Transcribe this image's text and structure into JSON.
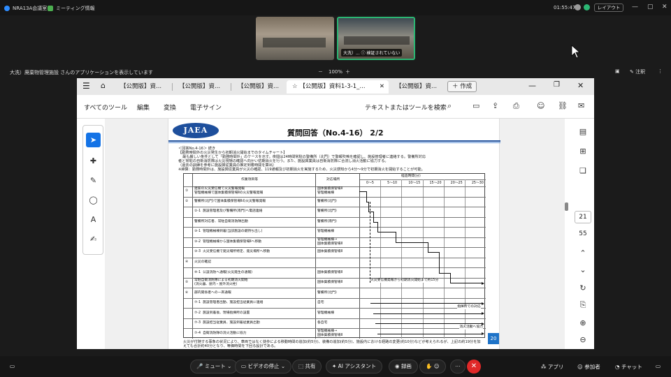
{
  "topbar": {
    "meeting_name": "NRA13A会議室",
    "meeting_info": "ミーティング情報",
    "clock": "01:55:47",
    "layout_label": "レイアウト"
  },
  "thumbnails": {
    "speaker_label": "大洗）... ⓘ 検証されていない"
  },
  "sharebar": {
    "sharing_text": "大洗）廃棄物管理施設 さんのアプリケーションを表示しています",
    "zoom": "100%",
    "annotate_label": "注釈"
  },
  "browser": {
    "tabs": [
      "【公開版】資...",
      "【公開版】資...",
      "【公開版】資...",
      "【公開版】資料1-3-1_...",
      "【公開版】資..."
    ],
    "new_tab_label": "作成"
  },
  "acrobat_menu": {
    "items": [
      "すべてのツール",
      "編集",
      "変換",
      "電子サイン"
    ],
    "search_placeholder": "テキストまたはツールを検索"
  },
  "pager": {
    "current": "21",
    "total": "55"
  },
  "document": {
    "logo": "JAEA",
    "title": "質問回答（No.4-16） 2/2",
    "heading1": "＜回答No.4-16＞ 続き",
    "heading2": "【勤務時間外の火災発生から初期消火開始までのタイムチャート】",
    "lines": [
      "最も厳しい条件として「勤務時間外」のケースを示す。夜間は24時間常駐の警備所（北門）で警報吹鳴を確認し、施設管理者に連絡する。警備所対応",
      "者と常駐の自衛消防隊は火災現場の確認へ向かい初期消火を行う。また、施設興業員は自衛消防隊に合流し消火活動に協力する。",
      "（過去の訓練を参考に施設興従業員の推定到着時間を算出）",
      "※締算：勤務時間外は、施設興従業員が火災の確認、119通報及び初期消火を実施するため、火災感知から4分〜9分で初期消火を開始することが可能。"
    ],
    "table": {
      "header_item": "作業項目等",
      "header_place": "対応場所",
      "header_time": "経過時間(分)",
      "time_cols": [
        "0〜5",
        "5〜10",
        "10〜15",
        "15〜20",
        "20〜25",
        "25〜30"
      ],
      "rows": [
        {
          "no": "①",
          "item": "建家の火災受信機で火災警報発報\n管理機械棟で国体集積保管場Ⅱの火災警報発報",
          "place": "国体集積保管場Ⅱ\n管理機械棟"
        },
        {
          "no": "②",
          "item": "警備所(北門)で国体集積保管場Ⅱの火災警報発報",
          "place": "警備所(北門)"
        },
        {
          "no": "②-1",
          "item": "施設管理者及び警備所(南門)へ電話連絡",
          "place": "警備所(北門)"
        },
        {
          "no": "",
          "item": "警備所対応者、常駐自衛消防隊出動",
          "place": "警備所(南門)"
        },
        {
          "no": "③-1",
          "item": "管理機械棟到着(当該施設の鍵持ち出し)",
          "place": "管理機械棟"
        },
        {
          "no": "③-2",
          "item": "管理機械棟から国体集積保管場Ⅱへ移動",
          "place": "管理機械棟→\n国体集積保管場Ⅱ"
        },
        {
          "no": "③-3",
          "item": "火災受信機で発災場所特定、発災場所へ移動",
          "place": "国体集積保管場Ⅱ"
        },
        {
          "no": "④",
          "item": "火災の確認",
          "place": ""
        },
        {
          "no": "④-1",
          "item": "公設消防へ通報(火災発生の通報)",
          "place": "国体集積保管場Ⅱ"
        },
        {
          "no": "⑤",
          "item": "常駐自衛消防隊による初期消火開始\n(消火器、屋内・屋外消火栓)",
          "place": "国体集積保管場Ⅱ"
        },
        {
          "no": "⑥",
          "item": "部内関係者への一斉通報",
          "place": "警備所(北門)"
        },
        {
          "no": "⑦-1",
          "item": "施設管理者出勤、施設担当従業員に連絡",
          "place": "自宅"
        },
        {
          "no": "⑦-2",
          "item": "施設到着後、現場指揮所の設置",
          "place": "管理機械棟"
        },
        {
          "no": "⑦-3",
          "item": "施設担当従業員、施設到着従業員出勤",
          "place": "各自宅"
        },
        {
          "no": "⑦-4",
          "item": "自衛消防隊の消火活動に協力",
          "place": "管理機械棟→\n国体集積保管場Ⅱ"
        }
      ],
      "annotations": [
        "火災受信機発報から初期消火開始まで約15分",
        "指揮所での対応",
        "消火活動へ協力"
      ]
    },
    "footer": "火災が付随する事象の状況により、車両ではなく徒歩による移動時間の追加(約5分)、装備の追加(約5分)、施設内における経路の変更(約10分)などが考えられるが、上記の約19分を加えても合計約40分となり、等価時間を下回る設計である。",
    "page_number": "20"
  },
  "bottombar": {
    "mute": "ミュート",
    "video": "ビデオの停止",
    "share": "共有",
    "ai": "AI アシスタント",
    "record": "録画",
    "apps": "アプリ",
    "participants": "参加者",
    "chat": "チャット"
  }
}
